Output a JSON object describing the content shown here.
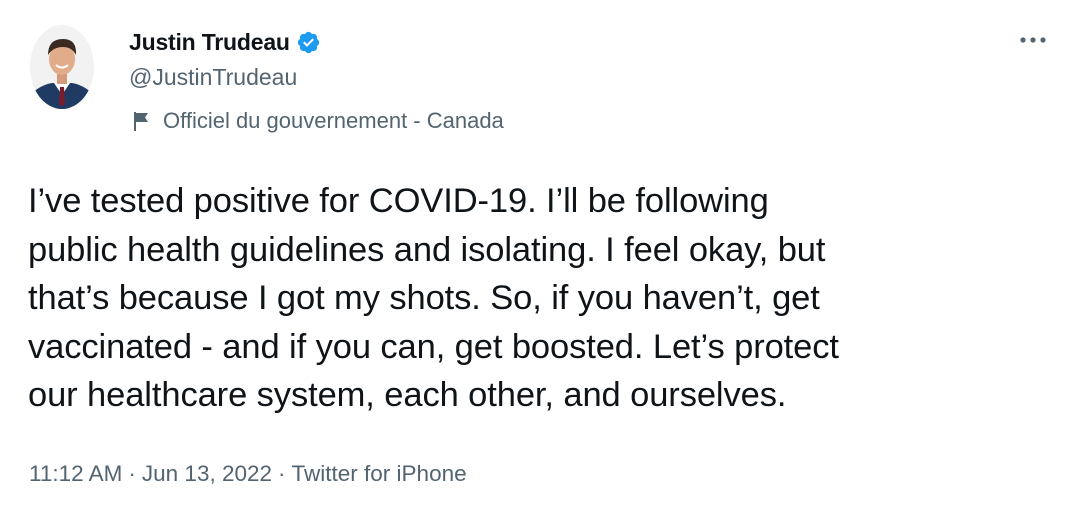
{
  "author": {
    "display_name": "Justin Trudeau",
    "handle": "@JustinTrudeau",
    "verified": true,
    "label": "Officiel du gouvernement - Canada"
  },
  "tweet": {
    "text": "I’ve tested positive for COVID-19. I’ll be following\npublic health guidelines and isolating. I feel okay, but\nthat’s because I got my shots. So, if you haven’t, get\nvaccinated - and if you can, get boosted. Let’s protect\nour healthcare system, each other, and ourselves.",
    "time": "11:12 AM",
    "date": "Jun 13, 2022",
    "source": "Twitter for iPhone",
    "separator": "·"
  },
  "icons": {
    "verified": "verified-badge-icon",
    "label": "flag-icon",
    "more": "more-horizontal-icon"
  },
  "colors": {
    "text_primary": "#0f1419",
    "text_secondary": "#536471",
    "verified_blue": "#1d9bf0",
    "background": "#ffffff"
  }
}
